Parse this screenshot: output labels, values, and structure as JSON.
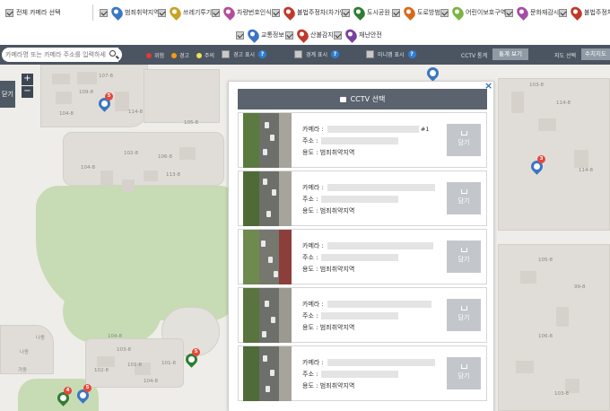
{
  "filters": {
    "all_label": "전체 카메라 선택",
    "items": [
      {
        "label": "범죄취약지역",
        "color": "#3a76c4",
        "icon": "police-pin-icon"
      },
      {
        "label": "쓰레기투기",
        "color": "#c9a227",
        "icon": "trash-pin-icon"
      },
      {
        "label": "차량번호인식",
        "color": "#b34d9b",
        "icon": "car-pin-icon"
      },
      {
        "label": "불법주정차(차가양)",
        "color": "#c0392b",
        "icon": "parking-pin-icon"
      },
      {
        "label": "도시공원",
        "color": "#2e7d32",
        "icon": "park-pin-icon"
      },
      {
        "label": "도로방범",
        "color": "#d66a1c",
        "icon": "road-pin-icon"
      },
      {
        "label": "어린이보호구역",
        "color": "#7cb342",
        "icon": "child-pin-icon"
      },
      {
        "label": "문화재감시",
        "color": "#a64ca6",
        "icon": "heritage-pin-icon"
      },
      {
        "label": "불법주정차",
        "color": "#c0392b",
        "icon": "parking-pin-icon"
      },
      {
        "label": "교통정보",
        "color": "#3a76c4",
        "icon": "traffic-pin-icon"
      },
      {
        "label": "산불감지",
        "color": "#c0392b",
        "icon": "fire-pin-icon"
      },
      {
        "label": "재난안전",
        "color": "#7b3fa0",
        "icon": "disaster-pin-icon"
      }
    ]
  },
  "toolbar": {
    "search_placeholder": "카메라명 또는 카메라 주소를 입력하세요",
    "legend": [
      {
        "label": "위험",
        "color": "#e53935"
      },
      {
        "label": "경고",
        "color": "#f39c12"
      },
      {
        "label": "주의",
        "color": "#f1e05a"
      }
    ],
    "warning_show_label": "경고 표시",
    "boundary_show_label": "경계 표시",
    "minimap_show_label": "미니맵 표시",
    "help_icon": "?",
    "cctv_stats_label": "CCTV 통계",
    "stats_view_button": "통계 보기",
    "map_select_label": "지도 선택",
    "map_select_value": "수치지도"
  },
  "map": {
    "zoom_in": "+",
    "zoom_out": "−",
    "side_tab": "닫기",
    "labels": [
      "107-8",
      "109-8",
      "104-8",
      "114-8",
      "105-8",
      "106-8",
      "104-8",
      "102-8",
      "113-8",
      "103-8",
      "101-8",
      "102-8",
      "104-8",
      "104-8",
      "101-8",
      "나동",
      "나동",
      "가동",
      "103-8",
      "114-8",
      "114-8",
      "105-8",
      "99-8",
      "106-8",
      "103-8"
    ],
    "pin_badges": [
      "5",
      "3",
      "5",
      "4",
      "5"
    ]
  },
  "modal": {
    "title": "CCTV 선택",
    "close": "×",
    "cameras": [
      {
        "camera_label": "카메라 :",
        "camera_suffix": "#1",
        "address_label": "주소 :",
        "usage": "용도 : 범죄취약지역",
        "button": "담기"
      },
      {
        "camera_label": "카메라 :",
        "camera_suffix": "",
        "address_label": "주소 :",
        "usage": "용도 : 범죄취약지역",
        "button": "담기"
      },
      {
        "camera_label": "카메라 :",
        "camera_suffix": "",
        "address_label": "주소 :",
        "usage": "용도 : 범죄취약지역",
        "button": "담기"
      },
      {
        "camera_label": "카메라 :",
        "camera_suffix": "",
        "address_label": "주소 :",
        "usage": "용도 : 범죄취약지역",
        "button": "담기"
      },
      {
        "camera_label": "카메라 :",
        "camera_suffix": "",
        "address_label": "주소 :",
        "usage": "용도 : 범죄취약지역",
        "button": "담기"
      }
    ]
  }
}
